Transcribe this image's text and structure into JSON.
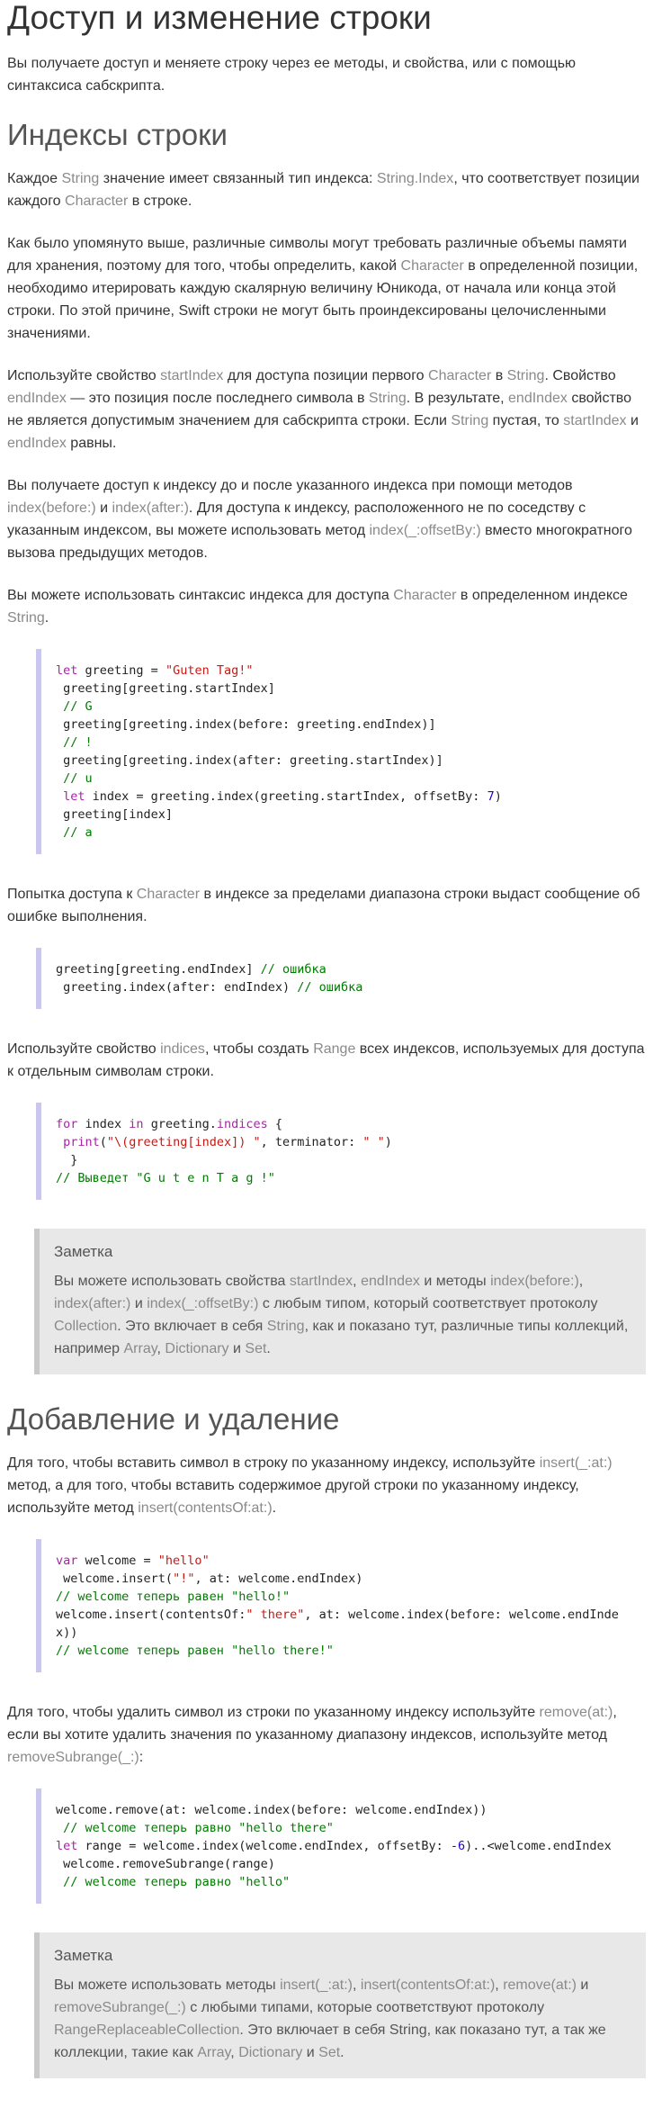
{
  "s1": {
    "title": "Доступ и изменение строки",
    "p1": "Вы получаете доступ и меняете строку через ее методы, и свойства, или с помощью синтаксиса сабскрипта."
  },
  "s2": {
    "title": "Индексы строки",
    "p1": [
      "Каждое ",
      "String",
      " значение имеет связанный тип индекса: ",
      "String.Index",
      ", что соответствует позиции каждого ",
      "Character",
      " в строке."
    ],
    "p2": [
      "Как было упомянуто выше, различные символы могут требовать различные объемы памяти для хранения, поэтому для того, чтобы определить, какой ",
      "Character",
      " в определенной позиции, необходимо итерировать каждую скалярную величину Юникода, от начала или конца этой строки. По этой причине, Swift строки не могут быть проиндексированы целочисленными значениями."
    ],
    "p3": [
      "Используйте свойство ",
      "startIndex",
      " для доступа позиции первого ",
      "Character",
      " в ",
      "String",
      ". Свойство ",
      "endIndex",
      " — это позиция после последнего символа в ",
      "String",
      ". В результате, ",
      "endIndex",
      " свойство не является допустимым значением для сабскрипта строки. Если ",
      "String",
      " пустая, то ",
      "startIndex",
      " и ",
      "endIndex",
      " равны."
    ],
    "p4": [
      "Вы получаете доступ к индексу до и после указанного индекса при помощи методов ",
      "index(before:)",
      " и ",
      "index(after:)",
      ". Для доступа к индексу, расположенного не по соседству с указанным индексом, вы можете использовать метод ",
      "index(_:offsetBy:)",
      " вместо многократного вызова предыдущих методов."
    ],
    "p5": [
      "Вы можете использовать синтаксис индекса для доступа ",
      "Character",
      " в определенном индексе ",
      "String",
      "."
    ],
    "code1": {
      "l1_kw": "let",
      "l1_a": " greeting = ",
      "l1_str": "\"Guten Tag!\"",
      "l2": " greeting[greeting.startIndex]",
      "l3": " // G",
      "l4": " greeting[greeting.index(before: greeting.endIndex)]",
      "l5": " // !",
      "l6": " greeting[greeting.index(after: greeting.startIndex)]",
      "l7": " // u",
      "l8_kw": " let",
      "l8_a": " index = greeting.index(greeting.startIndex, offsetBy: ",
      "l8_num": "7",
      "l8_b": ")",
      "l9": " greeting[index]",
      "l10": " // a"
    },
    "p6": [
      "Попытка доступа к ",
      "Character",
      " в индексе за пределами диапазона строки выдаст сообщение об ошибке выполнения."
    ],
    "code2": {
      "l1_a": "greeting[greeting.endIndex] ",
      "l1_cm": "// ошибка",
      "l2_a": " greeting.index(after: endIndex) ",
      "l2_cm": "// ошибка"
    },
    "p7": [
      "Используйте свойство ",
      "indices",
      ", чтобы создать ",
      "Range",
      " всех индексов, используемых для доступа к отдельным символам строки."
    ],
    "code3": {
      "l1_kw1": "for",
      "l1_a": " index ",
      "l1_kw2": "in",
      "l1_b": " greeting.",
      "l1_kw3": "indices",
      "l1_c": " {",
      "l2_kw": " print",
      "l2_a": "(",
      "l2_str1": "\"\\(greeting[index]) \"",
      "l2_b": ", terminator: ",
      "l2_str2": "\" \"",
      "l2_c": ")",
      "l3": "  }",
      "l4_cm": "// Выведет \"G u t e n T a g !\""
    },
    "note": {
      "title": "Заметка",
      "text": [
        "Вы можете использовать свойства ",
        "startIndex",
        ", ",
        "endIndex",
        " и методы ",
        "index(before:)",
        ", ",
        "index(after:)",
        " и ",
        "index(_:offsetBy:)",
        " с любым типом, который соответствует протоколу ",
        "Collection",
        ". Это включает в себя ",
        "String",
        ", как и показано тут, различные типы коллекций, например ",
        "Array",
        ", ",
        "Dictionary",
        " и ",
        "Set",
        "."
      ]
    }
  },
  "s3": {
    "title": "Добавление и удаление",
    "p1": [
      "Для того, чтобы вставить символ в строку по указанному индексу, используйте ",
      "insert(_:at:)",
      " метод, а для того, чтобы вставить содержимое другой строки по указанному индексу, используйте метод ",
      "insert(contentsOf:at:)",
      "."
    ],
    "code1": {
      "l1_kw": "var",
      "l1_a": " welcome = ",
      "l1_str": "\"hello\"",
      "l2_a": " welcome.insert(",
      "l2_str": "\"!\"",
      "l2_b": ", at: welcome.endIndex)",
      "l3_cm": "// welcome теперь равен \"hello!\"",
      "l4_a": "welcome.insert(contentsOf:",
      "l4_str": "\" there\"",
      "l4_b": ", at: welcome.index(before: welcome.endIndex))",
      "l5_cm": "// welcome теперь равен \"hello there!\""
    },
    "p2": [
      "Для того, чтобы удалить символ из строки по указанному индексу используйте ",
      "remove(at:)",
      ", если вы хотите удалить значения по указанному диапазону индексов, используйте метод ",
      "removeSubrange(_:)",
      ":"
    ],
    "code2": {
      "l1": "welcome.remove(at: welcome.index(before: welcome.endIndex))",
      "l2_cm": " // welcome теперь равно \"hello there\"",
      "l3_kw": "let",
      "l3_a": " range = welcome.index(welcome.endIndex, offsetBy: ",
      "l3_num": "-6",
      "l3_b": ")..<welcome.endIndex",
      "l4": " welcome.removeSubrange(range)",
      "l5_cm": " // welcome теперь равно \"hello\""
    },
    "note": {
      "title": "Заметка",
      "text": [
        "Вы можете использовать методы ",
        "insert(_:at:)",
        ", ",
        "insert(contentsOf:at:)",
        ", ",
        "remove(at:)",
        " и ",
        "removeSubrange(_:)",
        " с любыми типами, которые соответствуют протоколу ",
        "RangeReplaceableCollection",
        ". Это включает в себя String, как показано тут, а так же коллекции, такие как ",
        "Array",
        ", ",
        "Dictionary",
        " и ",
        "Set",
        "."
      ]
    }
  }
}
